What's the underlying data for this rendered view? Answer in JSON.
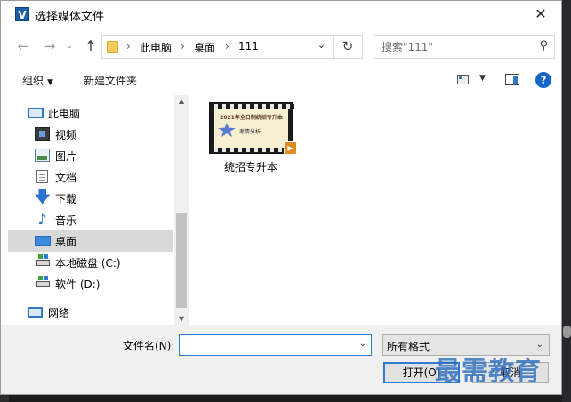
{
  "window": {
    "title": "选择媒体文件",
    "close_glyph": "✕"
  },
  "nav": {
    "back_glyph": "←",
    "forward_glyph": "→",
    "recent_glyph": "⌄",
    "up_glyph": "↑",
    "breadcrumb": [
      "此电脑",
      "桌面",
      "111"
    ],
    "separator": "›",
    "dropdown_glyph": "⌄",
    "refresh_glyph": "↻"
  },
  "search": {
    "placeholder": "搜索\"111\"",
    "icon_glyph": "⚲"
  },
  "toolbar": {
    "organize_label": "组织",
    "organize_caret": "▼",
    "new_folder_label": "新建文件夹",
    "view_caret": "▼",
    "help_glyph": "?"
  },
  "tree": [
    {
      "label": "此电脑",
      "icon": "computer-icon"
    },
    {
      "label": "视频",
      "icon": "videos-icon"
    },
    {
      "label": "图片",
      "icon": "pictures-icon"
    },
    {
      "label": "文档",
      "icon": "documents-icon"
    },
    {
      "label": "下载",
      "icon": "downloads-icon"
    },
    {
      "label": "音乐",
      "icon": "music-icon"
    },
    {
      "label": "桌面",
      "icon": "desktop-icon",
      "selected": true
    },
    {
      "label": "本地磁盘 (C:)",
      "icon": "drive-c-icon"
    },
    {
      "label": "软件 (D:)",
      "icon": "drive-d-icon"
    },
    {
      "label": "网络",
      "icon": "network-icon"
    }
  ],
  "tree_glyphs": {
    "download": "🡇",
    "music": "♪"
  },
  "scroll": {
    "up_glyph": "▲",
    "down_glyph": "▼"
  },
  "files": [
    {
      "name": "统招专升本",
      "thumb_title": "2021年全日制统招专升本",
      "thumb_subtitle": "考情分析",
      "play_glyph": "▶"
    }
  ],
  "footer": {
    "filename_label": "文件名(N):",
    "filename_value": "",
    "filename_dropdown_glyph": "⌄",
    "filetype_value": "所有格式",
    "filetype_caret": "⌄",
    "open_label": "打开(O)",
    "cancel_label": "取消"
  },
  "watermark": "最需教育",
  "colors": {
    "accent": "#2e7bd4",
    "help": "#1565c8",
    "selection": "#d9d9d9"
  }
}
